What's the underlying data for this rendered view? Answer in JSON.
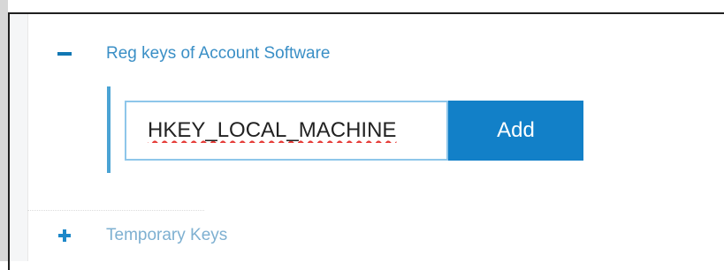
{
  "sections": [
    {
      "label": "Reg keys of Account Software",
      "expanded": true,
      "toggle_icon": "minus-icon"
    },
    {
      "label": "Temporary Keys",
      "expanded": false,
      "toggle_icon": "plus-icon"
    }
  ],
  "reg_key_input": {
    "value": "HKEY_LOCAL_MACHINE",
    "spellcheck_error": true
  },
  "add_button": {
    "label": "Add"
  },
  "colors": {
    "accent": "#1280c8",
    "link": "#3a8fc6",
    "input_border": "#8ec6ea",
    "spellcheck": "#e53935"
  }
}
